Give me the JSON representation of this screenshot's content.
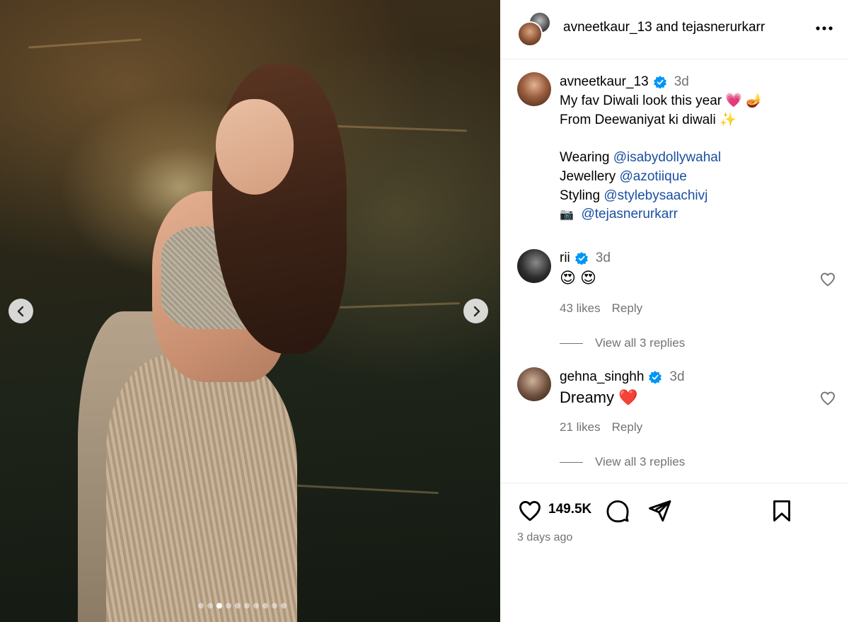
{
  "media": {
    "carousel": {
      "dot_count": 10,
      "active_index": 2
    }
  },
  "header": {
    "user1": "avneetkaur_13",
    "joiner": "and",
    "user2": "tejasnerurkarr"
  },
  "caption": {
    "username": "avneetkaur_13",
    "time": "3d",
    "line1": "My fav Diwali look this year",
    "line1_emoji": "💗 🪔",
    "line2": "From Deewaniyat ki diwali",
    "line2_emoji": "✨",
    "wearing_label": "Wearing",
    "wearing_mention": "@isabydollywahal",
    "jewellery_label": "Jewellery",
    "jewellery_mention": "@azotiique",
    "styling_label": "Styling",
    "styling_mention": "@stylebysaachivj",
    "camera_emoji": "📷",
    "photo_mention": "@tejasnerurkarr"
  },
  "comments": [
    {
      "username": "rii",
      "time": "3d",
      "text": "😍 😍",
      "likes": "43 likes",
      "reply": "Reply",
      "view_replies": "View all 3 replies"
    },
    {
      "username": "gehna_singhh",
      "time": "3d",
      "text": "Dreamy",
      "text_emoji": "❤️",
      "likes": "21 likes",
      "reply": "Reply",
      "view_replies": "View all 3 replies"
    }
  ],
  "actions": {
    "like_count": "149.5K",
    "posted": "3 days ago"
  },
  "colors": {
    "verified": "#0095f6",
    "mention": "#1a4fa3",
    "muted": "#737373"
  }
}
